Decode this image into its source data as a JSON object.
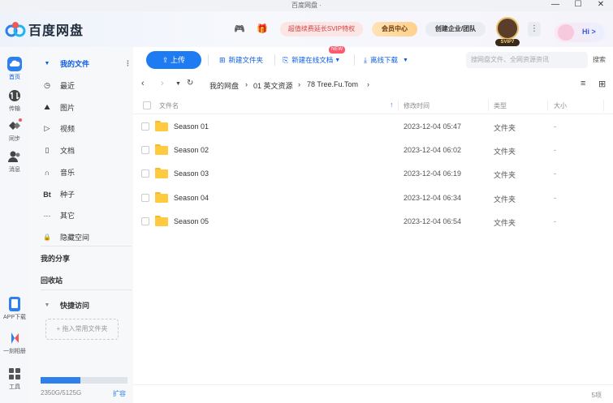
{
  "window": {
    "title": "百度网盘 · ",
    "minimize": "—",
    "maximize": "☐",
    "close": "✕"
  },
  "header": {
    "brand": "百度网盘",
    "promo_label": "超值续费延长SVIP特权",
    "vip_center_label": "会员中心",
    "enterprise_label": "创建企业/团队",
    "svip_badge": "SVIP7",
    "more_label": "⋮",
    "hi_label": "Hi >",
    "game_icon": "gamepad-icon",
    "gift_icon": "gift-icon"
  },
  "rail": {
    "items": [
      {
        "label": "首页",
        "icon": "cloud-home-icon",
        "active": true
      },
      {
        "label": "传输",
        "icon": "transfer-icon"
      },
      {
        "label": "同步",
        "icon": "sync-icon"
      },
      {
        "label": "消息",
        "icon": "message-icon"
      }
    ],
    "bottom": [
      {
        "label": "APP下载",
        "icon": "phone-icon"
      },
      {
        "label": "一刻相册",
        "icon": "album-icon"
      },
      {
        "label": "工具",
        "icon": "grid-tools-icon"
      }
    ]
  },
  "sidebar": {
    "my_files": "我的文件",
    "items": [
      {
        "glyph": "◷",
        "label": "最近"
      },
      {
        "glyph": "⛰",
        "label": "图片"
      },
      {
        "glyph": "▷",
        "label": "视频"
      },
      {
        "glyph": "▯",
        "label": "文档"
      },
      {
        "glyph": "∩",
        "label": "音乐"
      },
      {
        "glyph": "Bt",
        "label": "种子"
      },
      {
        "glyph": "···",
        "label": "其它"
      },
      {
        "glyph": "🔒",
        "label": "隐藏空间"
      }
    ],
    "my_share": "我的分享",
    "recycle": "回收站",
    "quick_access": "快捷访问",
    "drop_hint": "+ 拖入常用文件夹",
    "storage_text": "2350G/5125G",
    "storage_fraction": 0.459,
    "expand_label": "扩容"
  },
  "toolbar": {
    "upload": "上传",
    "new_folder": "新建文件夹",
    "new_online_doc": "新建在线文档",
    "new_badge": "NEW",
    "offline_download": "离线下载",
    "search_placeholder": "搜网盘文件、全网资源资讯",
    "search_button": "搜索"
  },
  "breadcrumb": [
    "我的网盘",
    "01 英文资源",
    "78 Tree.Fu.Tom"
  ],
  "table": {
    "headers": {
      "name": "文件名",
      "modified": "修改时间",
      "type": "类型",
      "size": "大小"
    },
    "rows": [
      {
        "name": "Season 01",
        "modified": "2023-12-04 05:47",
        "type": "文件夹",
        "size": "-"
      },
      {
        "name": "Season 02",
        "modified": "2023-12-04 06:02",
        "type": "文件夹",
        "size": "-"
      },
      {
        "name": "Season 03",
        "modified": "2023-12-04 06:19",
        "type": "文件夹",
        "size": "-"
      },
      {
        "name": "Season 04",
        "modified": "2023-12-04 06:34",
        "type": "文件夹",
        "size": "-"
      },
      {
        "name": "Season 05",
        "modified": "2023-12-04 06:54",
        "type": "文件夹",
        "size": "-"
      }
    ],
    "count": "5项"
  }
}
